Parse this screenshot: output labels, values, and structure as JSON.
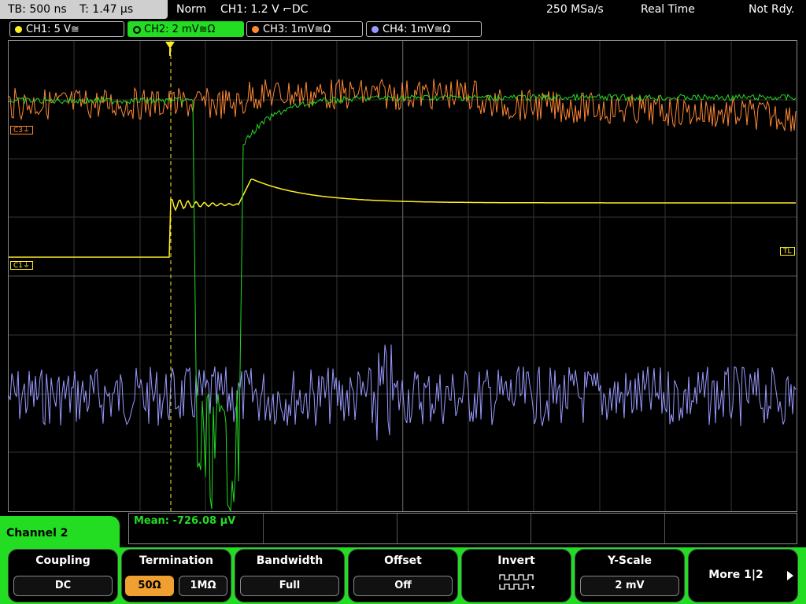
{
  "topbar": {
    "timebase": "TB: 500 ns",
    "trigger_time": "T: 1.47 µs",
    "mode": "Norm",
    "trigger": "CH1: 1.2 V ⌐DC",
    "samplerate": "250 MSa/s",
    "acq": "Real Time",
    "status": "Not Rdy."
  },
  "channels": [
    {
      "label": "CH1: 5 V≅",
      "color": "#ffee22"
    },
    {
      "label": "CH2: 2 mV≅Ω",
      "color": "#22dd22"
    },
    {
      "label": "CH3: 1mV≅Ω",
      "color": "#ff8833"
    },
    {
      "label": "CH4: 1mV≅Ω",
      "color": "#9999ff"
    }
  ],
  "markers": {
    "c3": "C3⏚",
    "c1": "C1⏚",
    "tl": "TL",
    "trig": "T"
  },
  "measurement": {
    "mean": "Mean: -726.08 µV"
  },
  "menu": {
    "title": "Channel 2",
    "coupling": {
      "label": "Coupling",
      "value": "DC"
    },
    "termination": {
      "label": "Termination",
      "opt_50": "50Ω",
      "opt_1m": "1MΩ"
    },
    "bandwidth": {
      "label": "Bandwidth",
      "value": "Full"
    },
    "offset": {
      "label": "Offset",
      "value": "Off"
    },
    "invert": {
      "label": "Invert"
    },
    "yscale": {
      "label": "Y-Scale",
      "value": "2 mV"
    },
    "more": {
      "label": "More 1|2"
    }
  }
}
